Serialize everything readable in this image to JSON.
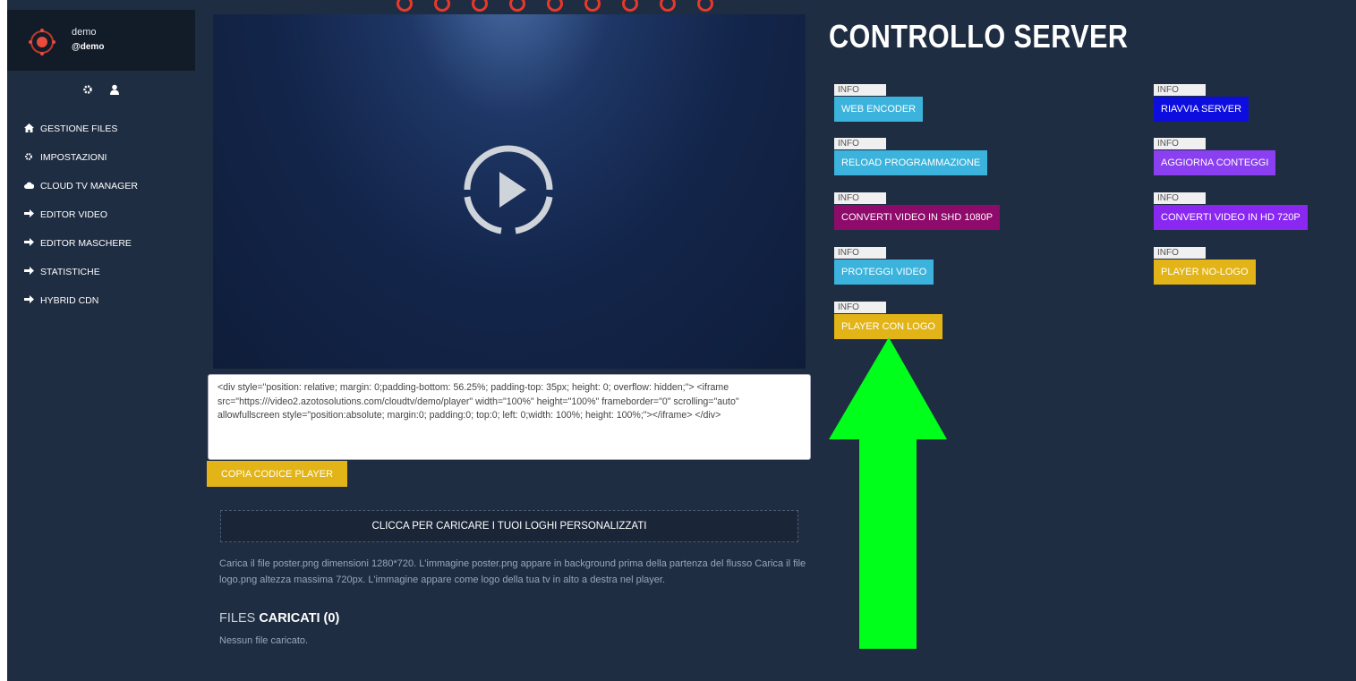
{
  "profile": {
    "name": "demo",
    "handle": "@demo"
  },
  "sidebar": {
    "items": [
      {
        "label": "GESTIONE FILES",
        "icon": "home-icon"
      },
      {
        "label": "IMPOSTAZIONI",
        "icon": "gear-icon"
      },
      {
        "label": "CLOUD TV MANAGER",
        "icon": "cloud-icon"
      },
      {
        "label": "EDITOR VIDEO",
        "icon": "arrow-right-icon"
      },
      {
        "label": "EDITOR MASCHERE",
        "icon": "arrow-right-icon"
      },
      {
        "label": "STATISTICHE",
        "icon": "arrow-right-icon"
      },
      {
        "label": "HYBRID CDN",
        "icon": "arrow-right-icon"
      }
    ]
  },
  "embed": {
    "code": "<div style=\"position: relative; margin: 0;padding-bottom: 56.25%; padding-top: 35px; height: 0; overflow: hidden;\"> <iframe src=\"https:///video2.azotosolutions.com/cloudtv/demo/player\" width=\"100%\" height=\"100%\" frameborder=\"0\" scrolling=\"auto\" allowfullscreen style=\"position:absolute; margin:0; padding:0; top:0; left: 0;width: 100%; height: 100%;\"></iframe> </div>",
    "copy_label": "COPIA CODICE PLAYER"
  },
  "upload": {
    "button_label": "CLICCA PER CARICARE I TUOI LOGHI PERSONALIZZATI",
    "description": "Carica il file poster.png dimensioni 1280*720. L'immagine poster.png appare in background prima della partenza del flusso Carica il file logo.png altezza massima 720px. L'immagine appare come logo della tua tv in alto a destra nel player.",
    "files_title_light": "FILES ",
    "files_title_bold": "CARICATI (0)",
    "no_files": "Nessun file caricato."
  },
  "server": {
    "title": "CONTROLLO SERVER",
    "info_label": "INFO",
    "commands": [
      {
        "label": "WEB ENCODER",
        "color": "#3bb3dc"
      },
      {
        "label": "RIAVVIA SERVER",
        "color": "#0d0de0"
      },
      {
        "label": "RELOAD PROGRAMMAZIONE",
        "color": "#3bb3dc"
      },
      {
        "label": "AGGIORNA CONTEGGI",
        "color": "#8a3ff0"
      },
      {
        "label": "CONVERTI VIDEO IN SHD 1080P",
        "color": "#8e0a6b"
      },
      {
        "label": "CONVERTI VIDEO IN HD 720P",
        "color": "#8a28f2"
      },
      {
        "label": "PROTEGGI VIDEO",
        "color": "#3bb3dc"
      },
      {
        "label": "PLAYER NO-LOGO",
        "color": "#e3b417"
      },
      {
        "label": "PLAYER CON LOGO",
        "color": "#e3b417"
      }
    ]
  },
  "annotation": {
    "arrow_color": "#00ff1a"
  }
}
